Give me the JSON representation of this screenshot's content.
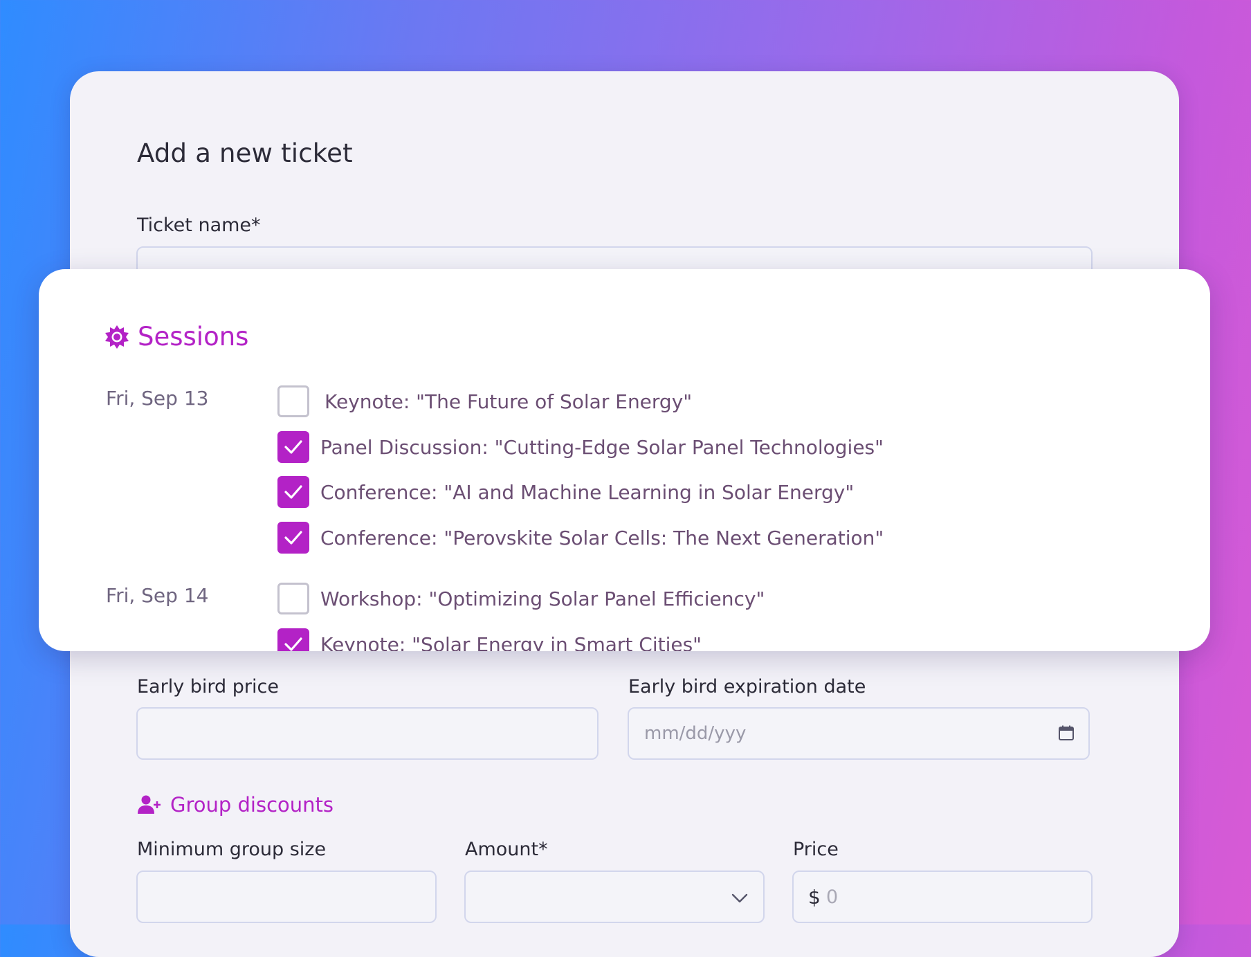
{
  "form": {
    "title": "Add a new ticket",
    "ticket_name_label": "Ticket name*",
    "ticket_name_value": "",
    "early_bird_price_label": "Early bird price",
    "early_bird_price_value": "",
    "early_bird_expiration_label": "Early bird expiration date",
    "early_bird_expiration_placeholder": "mm/dd/yyy",
    "group_discounts_title": "Group discounts",
    "min_group_size_label": "Minimum group size",
    "min_group_size_value": "",
    "amount_label": "Amount*",
    "amount_selected": "",
    "price_label": "Price",
    "price_currency": "$",
    "price_placeholder": "0"
  },
  "sessions": {
    "title": "Sessions",
    "days": [
      {
        "date": "Fri, Sep 13",
        "items": [
          {
            "label": "Keynote: \"The Future of Solar Energy\"",
            "checked": false
          },
          {
            "label": "Panel Discussion: \"Cutting-Edge Solar Panel Technologies\"",
            "checked": true
          },
          {
            "label": "Conference: \"AI and Machine Learning in Solar Energy\"",
            "checked": true
          },
          {
            "label": "Conference: \"Perovskite Solar Cells: The Next Generation\"",
            "checked": true
          }
        ]
      },
      {
        "date": "Fri, Sep 14",
        "items": [
          {
            "label": "Workshop: \"Optimizing Solar Panel Efficiency\"",
            "checked": false
          },
          {
            "label": "Keynote: \"Solar Energy in Smart Cities\"",
            "checked": true
          }
        ]
      }
    ]
  },
  "colors": {
    "accent": "#b322c6",
    "text": "#2c2b38",
    "session_text": "#6b4e73"
  },
  "icons": {
    "sessions": "sun-gear-icon",
    "group_discounts": "add-user-icon",
    "date_picker": "calendar-icon",
    "dropdown": "chevron-down-icon",
    "checkbox_checked": "checkmark-icon"
  }
}
